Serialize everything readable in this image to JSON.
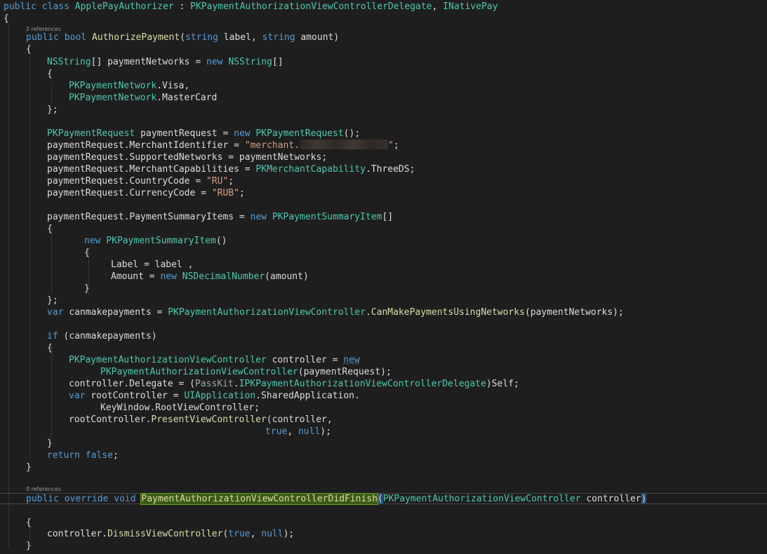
{
  "editor": {
    "codelens": {
      "authorize_refs": "2 references",
      "didfinish_refs": "0 references"
    },
    "l1": {
      "a": "public",
      "b": "class",
      "c": "ApplePayAuthorizer",
      "d": ":",
      "e": "PKPaymentAuthorizationViewControllerDelegate",
      "f": ",",
      "g": "INativePay"
    },
    "l2": {
      "a": "{"
    },
    "l3": {
      "a": "public",
      "b": "bool",
      "c": "AuthorizePayment",
      "d": "(",
      "e": "string",
      "f": "label,",
      "g": "string",
      "h": "amount)"
    },
    "l4": {
      "a": "{"
    },
    "l5": {
      "a": "NSString",
      "b": "[] paymentNetworks =",
      "c": "new",
      "d": "NSString",
      "e": "[]"
    },
    "l6": {
      "a": "{"
    },
    "l7": {
      "a": "PKPaymentNetwork",
      "b": ".Visa,"
    },
    "l8": {
      "a": "PKPaymentNetwork",
      "b": ".MasterCard"
    },
    "l9": {
      "a": "};"
    },
    "l10": {
      "a": "PKPaymentRequest",
      "b": "paymentRequest =",
      "c": "new",
      "d": "PKPaymentRequest",
      "e": "();"
    },
    "l11": {
      "a": "paymentRequest.MerchantIdentifier =",
      "b": "\"merchant.",
      "c": "\"",
      "d": ";"
    },
    "l12": {
      "a": "paymentRequest.SupportedNetworks = paymentNetworks;"
    },
    "l13": {
      "a": "paymentRequest.MerchantCapabilities =",
      "b": "PKMerchantCapability",
      "c": ".ThreeDS;"
    },
    "l14": {
      "a": "paymentRequest.CountryCode =",
      "b": "\"RU\"",
      "c": ";"
    },
    "l15": {
      "a": "paymentRequest.CurrencyCode =",
      "b": "\"RUB\"",
      "c": ";"
    },
    "l16": {
      "a": "paymentRequest.PaymentSummaryItems =",
      "b": "new",
      "c": "PKPaymentSummaryItem",
      "d": "[]"
    },
    "l17": {
      "a": "{"
    },
    "l18": {
      "a": "new",
      "b": "PKPaymentSummaryItem",
      "c": "()"
    },
    "l19": {
      "a": "{"
    },
    "l20": {
      "a": "Label = label ,"
    },
    "l21": {
      "a": "Amount =",
      "b": "new",
      "c": "NSDecimalNumber",
      "d": "(amount)"
    },
    "l22": {
      "a": "}"
    },
    "l23": {
      "a": "};"
    },
    "l24": {
      "a": "var",
      "b": "canmakepayments =",
      "c": "PKPaymentAuthorizationViewController",
      "d": ".",
      "e": "CanMakePaymentsUsingNetworks",
      "f": "(paymentNetworks);"
    },
    "l25": {
      "a": "if",
      "b": "(canmakepayments)"
    },
    "l26": {
      "a": "{"
    },
    "l27": {
      "a": "PKPaymentAuthorizationViewController",
      "b": "controller =",
      "c": "new"
    },
    "l28": {
      "a": "PKPaymentAuthorizationViewController",
      "b": "(paymentRequest);"
    },
    "l29": {
      "a": "controller.Delegate = (",
      "b": "PassKit",
      "c": ".",
      "d": "IPKPaymentAuthorizationViewControllerDelegate",
      "e": ")Self;"
    },
    "l30": {
      "a": "var",
      "b": "rootController =",
      "c": "UIApplication",
      "d": ".SharedApplication."
    },
    "l31": {
      "a": "KeyWindow.RootViewController;"
    },
    "l32": {
      "a": "rootController.",
      "b": "PresentViewController",
      "c": "(controller,"
    },
    "l33": {
      "a": "true",
      "b": ",",
      "c": "null",
      "d": ");"
    },
    "l34": {
      "a": "}"
    },
    "l35": {
      "a": "return",
      "b": "false",
      "c": ";"
    },
    "l36": {
      "a": "}"
    },
    "l37": {
      "a": "public",
      "b": "override",
      "c": "void",
      "d": "PaymentAuthorizationViewControllerDidFinish",
      "e": "(",
      "f": "PKPaymentAuthorizationViewController",
      "g": "controller",
      "h": ")"
    },
    "l38": {
      "a": "{"
    },
    "l39": {
      "a": "controller.",
      "b": "DismissViewController",
      "c": "(",
      "d": "true",
      "e": ",",
      "f": "null",
      "g": ");"
    },
    "l40": {
      "a": "}"
    }
  }
}
